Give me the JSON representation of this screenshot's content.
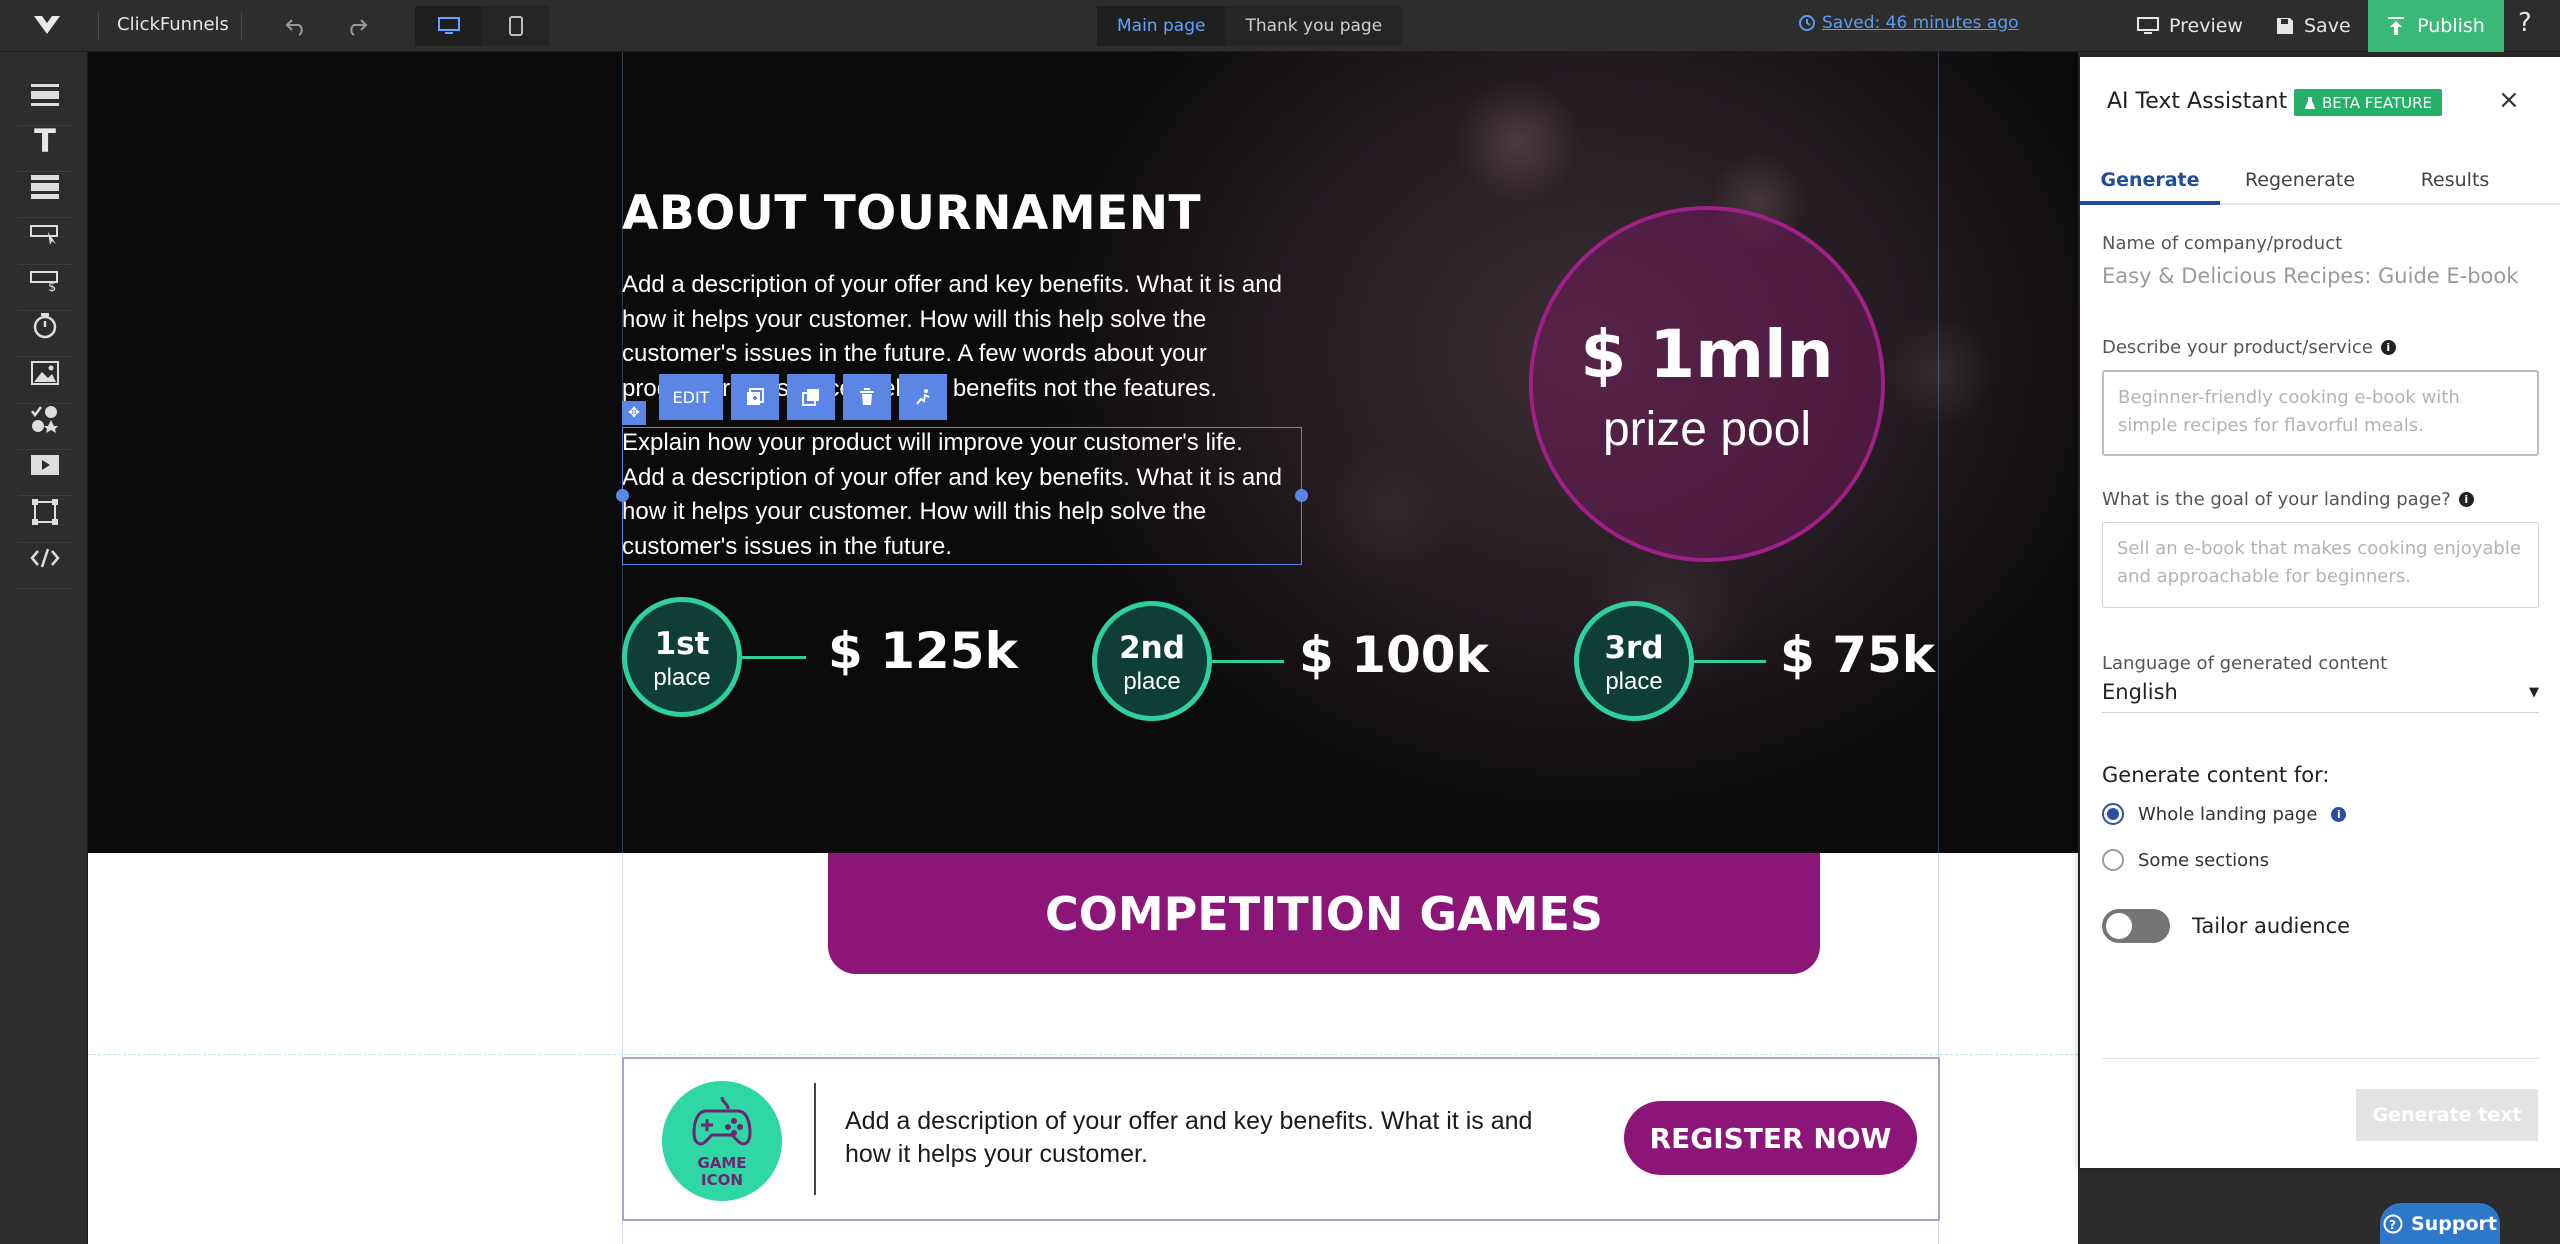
{
  "app": {
    "name": "ClickFunnels",
    "pages": [
      "Main page",
      "Thank you page"
    ],
    "active_page": "Main page",
    "saved_status": "Saved: 46 minutes ago",
    "preview_label": "Preview",
    "save_label": "Save",
    "publish_label": "Publish",
    "help_label": "?"
  },
  "sidebar": {
    "tools": [
      "sections-tool",
      "text-tool",
      "rows-tool",
      "button-tool",
      "pricing-tool",
      "countdown-tool",
      "image-tool",
      "icons-tool",
      "video-tool",
      "shape-tool",
      "code-tool"
    ]
  },
  "canvas": {
    "about_title": "ABOUT TOURNAMENT",
    "about_paragraph_1": "Add a description of your offer and key benefits. What it is and how it helps your customer. How will this help solve the customer's issues in the future. A few words about your product or the service. Sell the benefits not the features.",
    "about_paragraph_2": "Explain how your product will improve your customer's life. Add a description of your offer and key benefits. What it is and how it helps your customer. How will this help solve the customer's issues in the future.",
    "edit_label": "EDIT",
    "prize_amount": "$ 1mln",
    "prize_label": "prize pool",
    "places": [
      {
        "num": "1st",
        "word": "place",
        "amount": "$ 125k"
      },
      {
        "num": "2nd",
        "word": "place",
        "amount": "$ 100k"
      },
      {
        "num": "3rd",
        "word": "place",
        "amount": "$ 75k"
      }
    ],
    "games_title": "COMPETITION GAMES",
    "game_icon_label_1": "GAME",
    "game_icon_label_2": "ICON",
    "game_text": "Add a description of your offer and key benefits. What it is and how it helps your customer.",
    "register_label": "REGISTER NOW",
    "support_label": "Support"
  },
  "ai_panel": {
    "title": "AI Text Assistant",
    "beta_label": "BETA FEATURE",
    "tabs": [
      "Generate",
      "Regenerate",
      "Results"
    ],
    "active_tab": "Generate",
    "company_label": "Name of company/product",
    "company_value": "Easy & Delicious Recipes: Guide E-book",
    "describe_label": "Describe your product/service",
    "describe_placeholder": "Beginner-friendly cooking e-book with simple recipes for flavorful meals.",
    "goal_label": "What is the goal of your landing page?",
    "goal_placeholder": "Sell an e-book that makes cooking enjoyable and approachable for beginners.",
    "language_label": "Language of generated content",
    "language_value": "English",
    "generate_for_label": "Generate content for:",
    "options": [
      "Whole landing page",
      "Some sections"
    ],
    "selected_option": "Whole landing page",
    "tailor_label": "Tailor audience",
    "tailor_on": false,
    "generate_button": "Generate text"
  },
  "colors": {
    "accent_blue": "#5b86e5",
    "publish_green": "#3bb976",
    "brand_purple": "#8c1677",
    "place_green": "#2ed19e"
  }
}
